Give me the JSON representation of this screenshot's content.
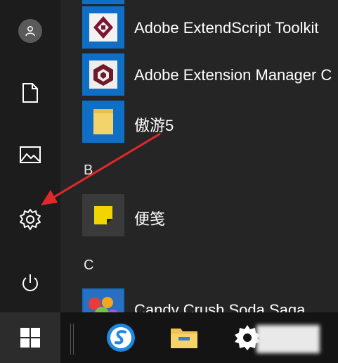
{
  "apps": [
    {
      "label": "Adobe ExtendScript Toolkit",
      "icon": "extendscript-icon"
    },
    {
      "label": "Adobe Extension Manager C",
      "icon": "extension-manager-icon"
    },
    {
      "label": "傲游5",
      "icon": "maxthon-folder-icon"
    },
    {
      "label": "便笺",
      "icon": "sticky-notes-icon"
    },
    {
      "label": "Candy Crush Soda Saga",
      "icon": "candy-crush-icon"
    }
  ],
  "sections": {
    "b": "B",
    "c": "C"
  },
  "rail": [
    "user-avatar",
    "documents-icon",
    "pictures-icon",
    "settings-icon",
    "power-icon"
  ],
  "taskbar": [
    "windows-start-icon",
    "sogou-browser-icon",
    "file-explorer-icon",
    "settings-gear-icon"
  ],
  "colors": {
    "tile_blue": "#0f6fc6",
    "annotation_arrow": "#e0292b",
    "background": "#1f1f1f"
  }
}
